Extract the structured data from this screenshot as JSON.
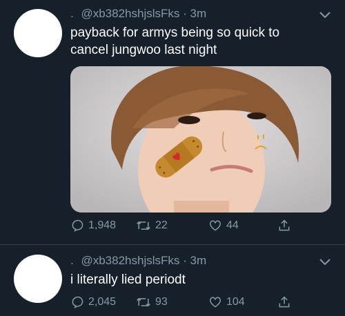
{
  "tweets": [
    {
      "handle_prefix": ".",
      "handle": "@xb382hshjslsFks",
      "separator": "·",
      "time": "3m",
      "text_lines": [
        "payback for armys being so quick to",
        "cancel jungwoo last night"
      ],
      "has_media": true,
      "replies": "1,948",
      "retweets": "22",
      "likes": "44"
    },
    {
      "handle_prefix": ".",
      "handle": "@xb382hshjslsFks",
      "separator": "·",
      "time": "3m",
      "text_lines": [
        "i literally lied periodt"
      ],
      "has_media": false,
      "replies": "2,045",
      "retweets": "93",
      "likes": "104"
    }
  ],
  "colors": {
    "background": "#15202b",
    "secondary_text": "#8899a6",
    "divider": "#38444d"
  },
  "icons": [
    "reply-icon",
    "retweet-icon",
    "like-icon",
    "share-icon",
    "chevron-down-icon"
  ]
}
